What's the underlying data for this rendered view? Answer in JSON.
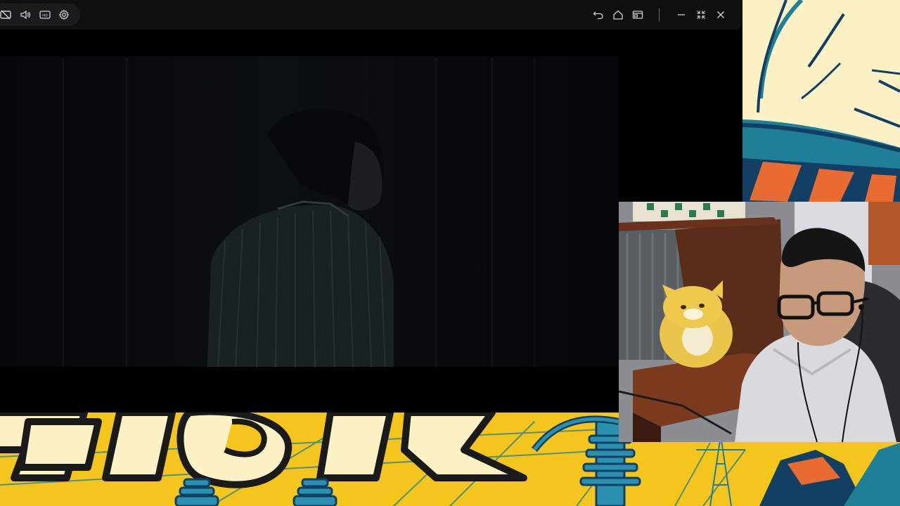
{
  "window": {
    "title_icons_left": [
      "subtitles-off-icon",
      "volume-icon",
      "hd-icon",
      "gear-icon"
    ],
    "hd_badge": "Hd",
    "title_icons_right": [
      "undo-icon",
      "home-icon",
      "picture-in-picture-icon",
      "minimize-icon",
      "fullscreen-exit-icon",
      "close-icon"
    ]
  },
  "colors": {
    "comic_yellow": "#f4c51d",
    "comic_cream": "#fdf1c6",
    "comic_teal": "#1f7f96",
    "comic_navy": "#123f63",
    "comic_orange": "#e86b32",
    "titlebar_bg": "#0f0f10"
  }
}
